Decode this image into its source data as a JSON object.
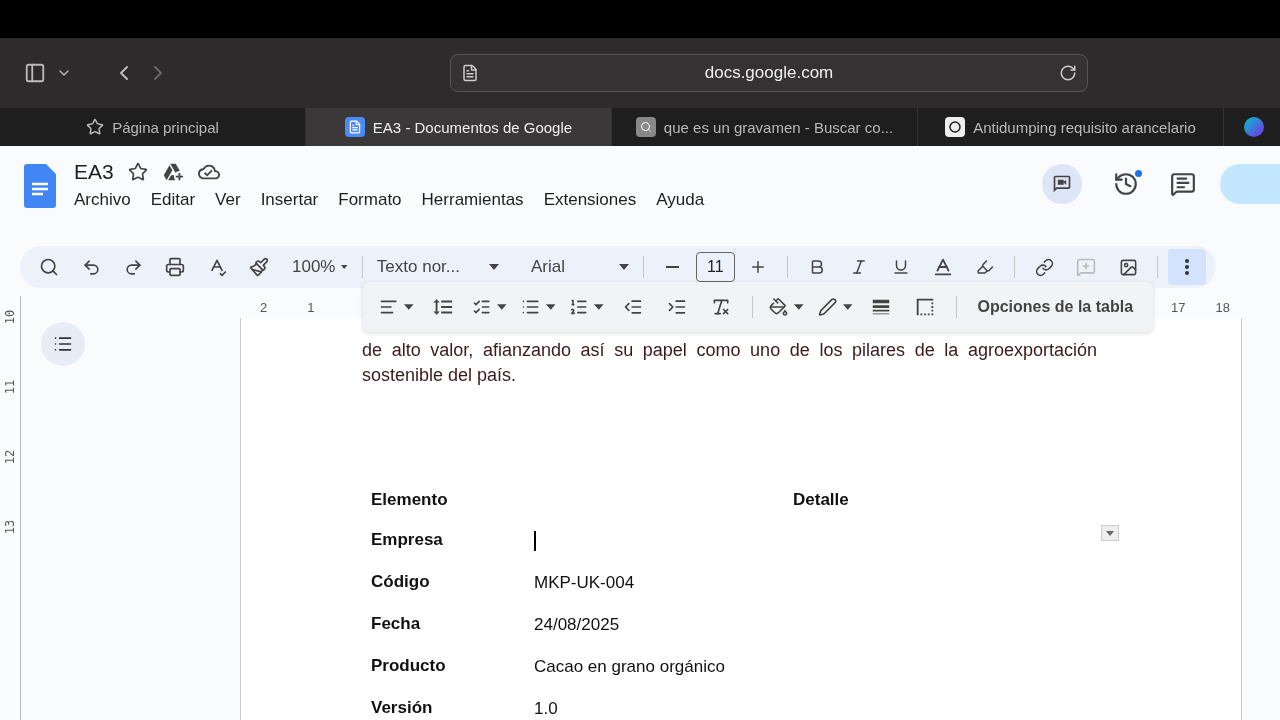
{
  "browser": {
    "url": "docs.google.com",
    "tabs": [
      {
        "kind": "home",
        "title": "Página principal",
        "selected": false
      },
      {
        "kind": "docs",
        "title": "EA3 - Documentos de Google",
        "selected": true
      },
      {
        "kind": "search",
        "title": "que es un gravamen - Buscar co...",
        "selected": false
      },
      {
        "kind": "chat",
        "title": "Antidumping requisito arancelario",
        "selected": false
      },
      {
        "kind": "circle",
        "selected": false
      }
    ]
  },
  "document": {
    "title": "EA3",
    "menu": [
      "Archivo",
      "Editar",
      "Ver",
      "Insertar",
      "Formato",
      "Herramientas",
      "Extensiones",
      "Ayuda"
    ]
  },
  "toolbar": {
    "zoom": "100%",
    "style": "Texto nor...",
    "font": "Arial",
    "font_size": "11",
    "add_comment_disabled": true,
    "more_selected": true
  },
  "table_toolbar": {
    "options_button": "Opciones de la tabla"
  },
  "ruler": {
    "left_marks": [
      "2",
      "1"
    ],
    "right_marks": [
      "17",
      "18"
    ],
    "vertical_marks": [
      "10",
      "11",
      "12",
      "13"
    ]
  },
  "paragraph": "de alto valor, afianzando así su papel como uno de los pilares de la agroexportación sostenible del país.",
  "table": {
    "columns": [
      "Elemento",
      "Detalle"
    ],
    "rows": [
      {
        "label": "Empresa",
        "has_cursor": true
      },
      {
        "label": "Código",
        "value": "MKP-UK-004"
      },
      {
        "label": "Fecha",
        "value": "24/08/2025"
      },
      {
        "label": "Producto",
        "value": "Cacao en grano orgánico"
      },
      {
        "label": "Versión",
        "value": "1.0"
      }
    ]
  }
}
